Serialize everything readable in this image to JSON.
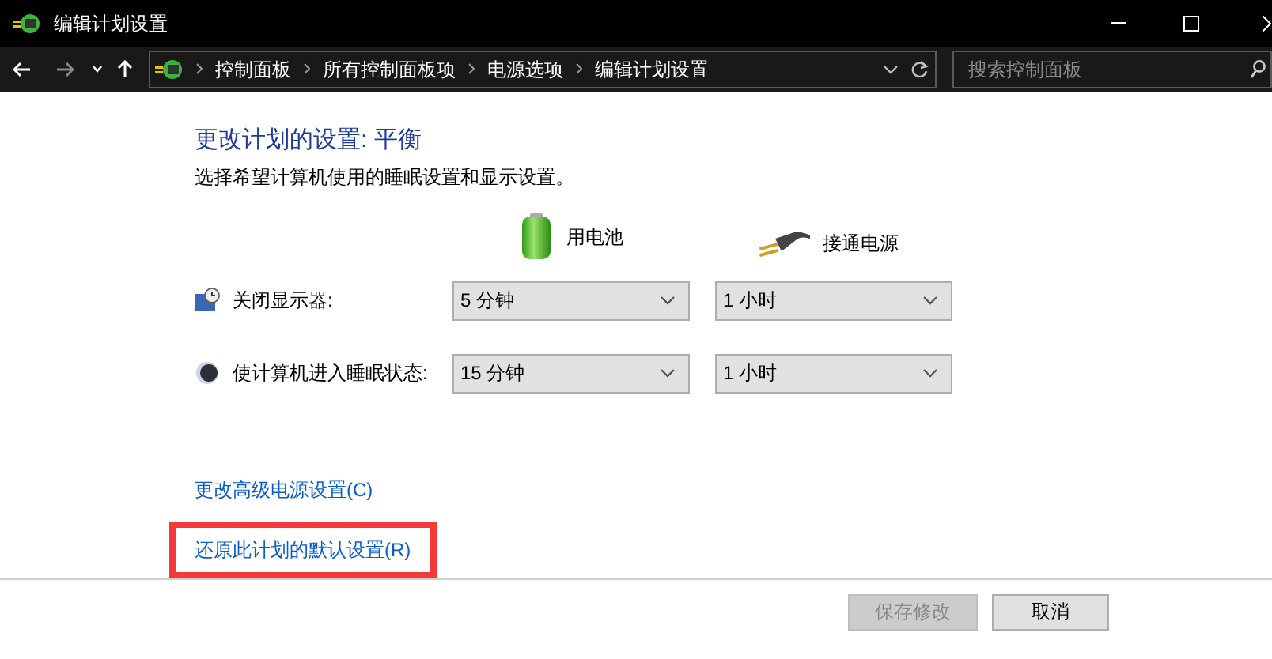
{
  "window": {
    "title": "编辑计划设置"
  },
  "address_bar": {
    "breadcrumbs": [
      "控制面板",
      "所有控制面板项",
      "电源选项",
      "编辑计划设置"
    ]
  },
  "search": {
    "placeholder": "搜索控制面板"
  },
  "heading": "更改计划的设置: 平衡",
  "description": "选择希望计算机使用的睡眠设置和显示设置。",
  "columns": [
    {
      "kind": "battery",
      "label": "用电池"
    },
    {
      "kind": "plug",
      "label": "接通电源"
    }
  ],
  "settings": [
    {
      "kind": "display",
      "label": "关闭显示器:",
      "values": [
        "5 分钟",
        "1 小时"
      ]
    },
    {
      "kind": "sleep",
      "label": "使计算机进入睡眠状态:",
      "values": [
        "15 分钟",
        "1 小时"
      ]
    }
  ],
  "links": [
    {
      "label": "更改高级电源设置(C)",
      "highlighted": false
    },
    {
      "label": "还原此计划的默认设置(R)",
      "highlighted": true
    }
  ],
  "buttons": [
    {
      "label": "保存修改",
      "disabled": true
    },
    {
      "label": "取消",
      "disabled": false
    }
  ]
}
